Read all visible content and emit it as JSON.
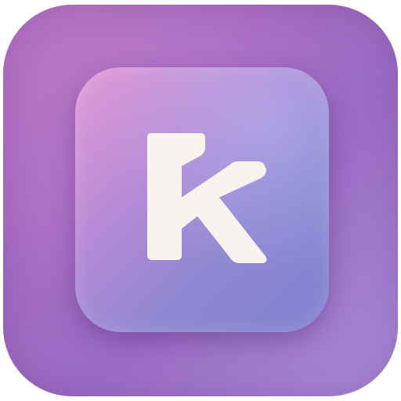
{
  "icon": {
    "glyph_name": "letter-k-icon",
    "colors": {
      "outer_primary": "#a56bc4",
      "inner_primary": "#b78ad6",
      "glyph": "#f8f3ef"
    }
  }
}
